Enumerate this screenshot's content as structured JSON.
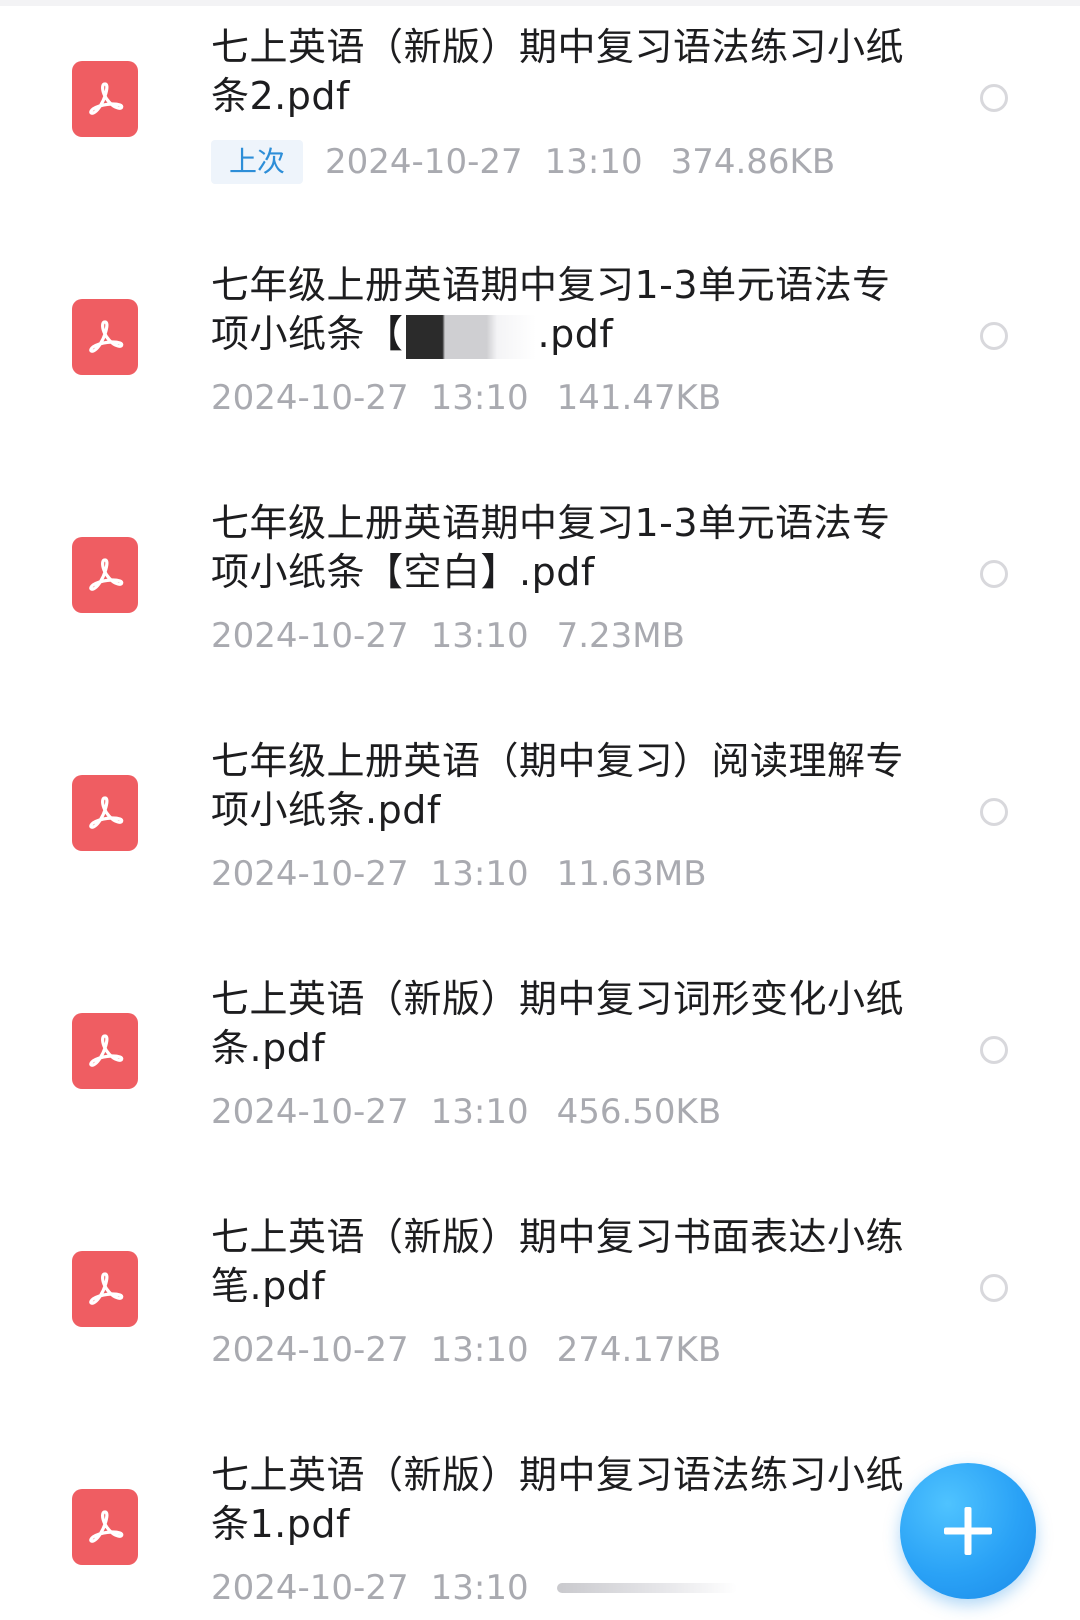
{
  "files": [
    {
      "title": "七上英语（新版）期中复习语法练习小纸条2.pdf",
      "badge": "上次",
      "date": "2024-10-27",
      "time": "13:10",
      "size": "374.86KB"
    },
    {
      "title_prefix": "七年级上册英语期中复习1-3单元语法专项小纸条【",
      "title_suffix": ".pdf",
      "date": "2024-10-27",
      "time": "13:10",
      "size": "141.47KB"
    },
    {
      "title": "七年级上册英语期中复习1-3单元语法专项小纸条【空白】.pdf",
      "date": "2024-10-27",
      "time": "13:10",
      "size": "7.23MB"
    },
    {
      "title": "七年级上册英语（期中复习）阅读理解专项小纸条.pdf",
      "date": "2024-10-27",
      "time": "13:10",
      "size": "11.63MB"
    },
    {
      "title": "七上英语（新版）期中复习词形变化小纸条.pdf",
      "date": "2024-10-27",
      "time": "13:10",
      "size": "456.50KB"
    },
    {
      "title": "七上英语（新版）期中复习书面表达小练笔.pdf",
      "date": "2024-10-27",
      "time": "13:10",
      "size": "274.17KB"
    },
    {
      "title": "七上英语（新版）期中复习语法练习小纸条1.pdf",
      "date": "2024-10-27",
      "time": "13:10"
    }
  ],
  "icons": {
    "file": "pdf-file-icon",
    "select": "select-radio",
    "fab": "plus-icon"
  },
  "colors": {
    "pdf_icon": "#ef5d62",
    "badge_text": "#2d8ed8",
    "fab": "#2aa2f6",
    "meta_text": "#a9aab0",
    "title_text": "#1d1d1f"
  }
}
